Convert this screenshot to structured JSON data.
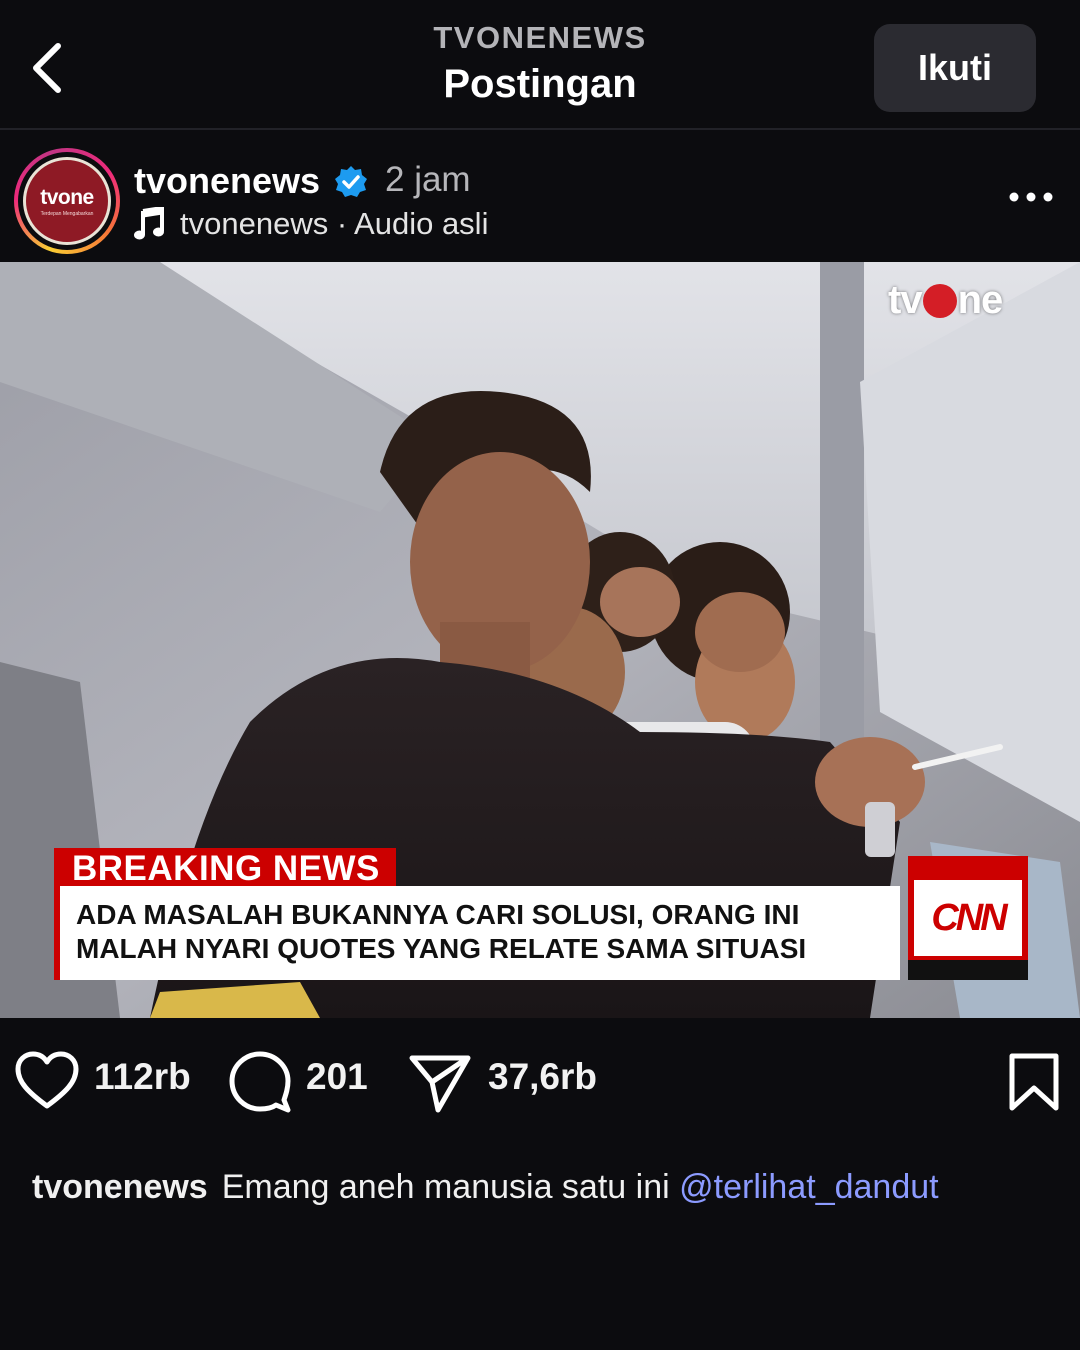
{
  "header": {
    "account": "TVONENEWS",
    "title": "Postingan",
    "follow_label": "Ikuti"
  },
  "post": {
    "username": "tvonenews",
    "time": "2 jam",
    "audio": "tvonenews · Audio asli",
    "avatar_text": "tvone",
    "avatar_tagline": "Terdepan Mengabarkan"
  },
  "media": {
    "watermark": "tv ne",
    "breaking_label": "BREAKING NEWS",
    "headline_lines": [
      "ADA MASALAH BUKANNYA CARI SOLUSI, ORANG INI",
      "MALAH NYARI QUOTES YANG RELATE SAMA SITUASI"
    ],
    "cnn_logo": "CNN"
  },
  "actions": {
    "likes": "112rb",
    "comments": "201",
    "shares": "37,6rb"
  },
  "caption": {
    "username": "tvonenews",
    "text": "Emang aneh manusia satu ini",
    "mention": "@terlihat_dandut"
  },
  "icons": {
    "back": "chevron-left-icon",
    "verified": "verified-badge-icon",
    "music": "music-note-icon",
    "more": "more-horizontal-icon",
    "like": "heart-icon",
    "comment": "comment-bubble-icon",
    "share": "paper-plane-icon",
    "save": "bookmark-icon"
  },
  "colors": {
    "background": "#0c0c0f",
    "follow_button": "#2b2b31",
    "verified": "#1d9bf0",
    "breaking_red": "#cc0000",
    "mention": "#8c9bff"
  }
}
